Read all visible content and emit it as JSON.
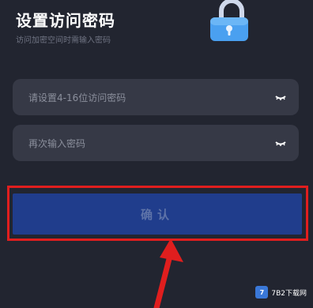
{
  "header": {
    "title": "设置访问密码",
    "subtitle": "访问加密空间时需输入密码"
  },
  "form": {
    "password_placeholder": "请设置4-16位访问密码",
    "confirm_placeholder": "再次输入密码",
    "submit_label": "确认"
  },
  "watermark": {
    "text": "7B2下载网"
  },
  "colors": {
    "background": "#222530",
    "field": "#363946",
    "button": "#203d8c",
    "highlight": "#e01e1e"
  }
}
